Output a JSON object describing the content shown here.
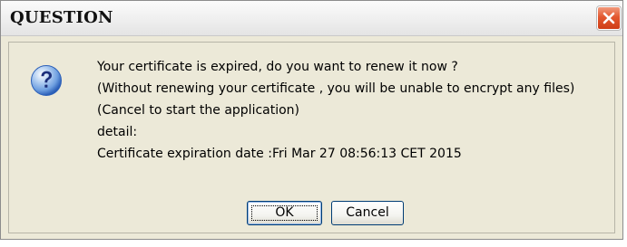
{
  "window": {
    "title": "QUESTION"
  },
  "icons": {
    "question": "question-icon",
    "close": "close-icon"
  },
  "message": {
    "lines": [
      "Your certificate is expired, do you want to renew it now ?",
      "(Without renewing your certificate , you will be unable to encrypt any files)",
      "(Cancel to start the application)",
      "detail:",
      "Certificate expiration date :Fri Mar 27 08:56:13 CET 2015"
    ]
  },
  "buttons": {
    "ok_label": "OK",
    "cancel_label": "Cancel"
  },
  "colors": {
    "dialog_background": "#ece9d8",
    "close_button": "#e3582f",
    "icon_blue": "#2b5fb8"
  }
}
